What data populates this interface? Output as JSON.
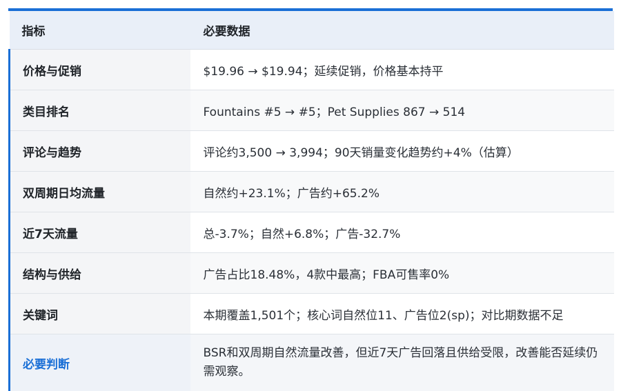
{
  "table": {
    "header": {
      "col1": "指标",
      "col2": "必要数据"
    },
    "rows": [
      {
        "metric": "价格与促销",
        "data": "$19.96 → $19.94；延续促销，价格基本持平"
      },
      {
        "metric": "类目排名",
        "data": "Fountains #5 → #5；Pet Supplies 867 → 514"
      },
      {
        "metric": "评论与趋势",
        "data": "评论约3,500 → 3,994；90天销量变化趋势约+4%（估算）"
      },
      {
        "metric": "双周期日均流量",
        "data": "自然约+23.1%；广告约+65.2%"
      },
      {
        "metric": "近7天流量",
        "data": "总-3.7%；自然+6.8%；广告-32.7%"
      },
      {
        "metric": "结构与供给",
        "data": "广告占比18.48%，4款中最高；FBA可售率0%"
      },
      {
        "metric": "关键词",
        "data": "本期覆盖1,501个；核心词自然位11、广告位2(sp)；对比期数据不足"
      }
    ],
    "judgment": {
      "label": "必要判断",
      "text": "BSR和双周期自然流量改善，但近7天广告回落且供给受限，改善能否延续仍需观察。"
    }
  },
  "colors": {
    "accent": "#1a6fd6",
    "header_bg": "#e9eff8",
    "key_bg": "#f4f5f7"
  }
}
